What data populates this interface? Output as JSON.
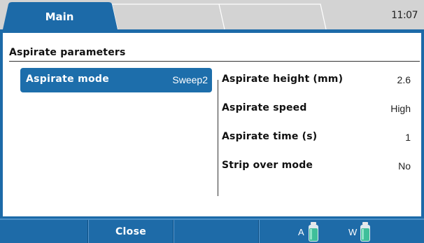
{
  "header": {
    "tabs": [
      {
        "label": "Main",
        "active": true
      },
      {
        "label": "",
        "active": false
      },
      {
        "label": "",
        "active": false
      },
      {
        "label": "",
        "active": false
      }
    ],
    "clock": "11:07"
  },
  "page": {
    "title": "Aspirate parameters",
    "left_items": [
      {
        "label": "Aspirate mode",
        "value": "Sweep2",
        "selected": true
      }
    ],
    "right_items": [
      {
        "label": "Aspirate height (mm)",
        "value": "2.6"
      },
      {
        "label": "Aspirate speed",
        "value": "High"
      },
      {
        "label": "Aspirate time (s)",
        "value": "1"
      },
      {
        "label": "Strip over mode",
        "value": "No"
      }
    ]
  },
  "footer": {
    "softkeys": [
      "",
      "Close",
      "",
      ""
    ],
    "bottles": [
      {
        "label": "A",
        "icon": "bottle-icon",
        "color": "#3fbf9a"
      },
      {
        "label": "W",
        "icon": "bottle-icon",
        "color": "#3fbf9a"
      }
    ]
  },
  "colors": {
    "accent": "#1c6aa8",
    "selected_row": "#1d6eab",
    "tab_bar": "#d3d3d3"
  }
}
